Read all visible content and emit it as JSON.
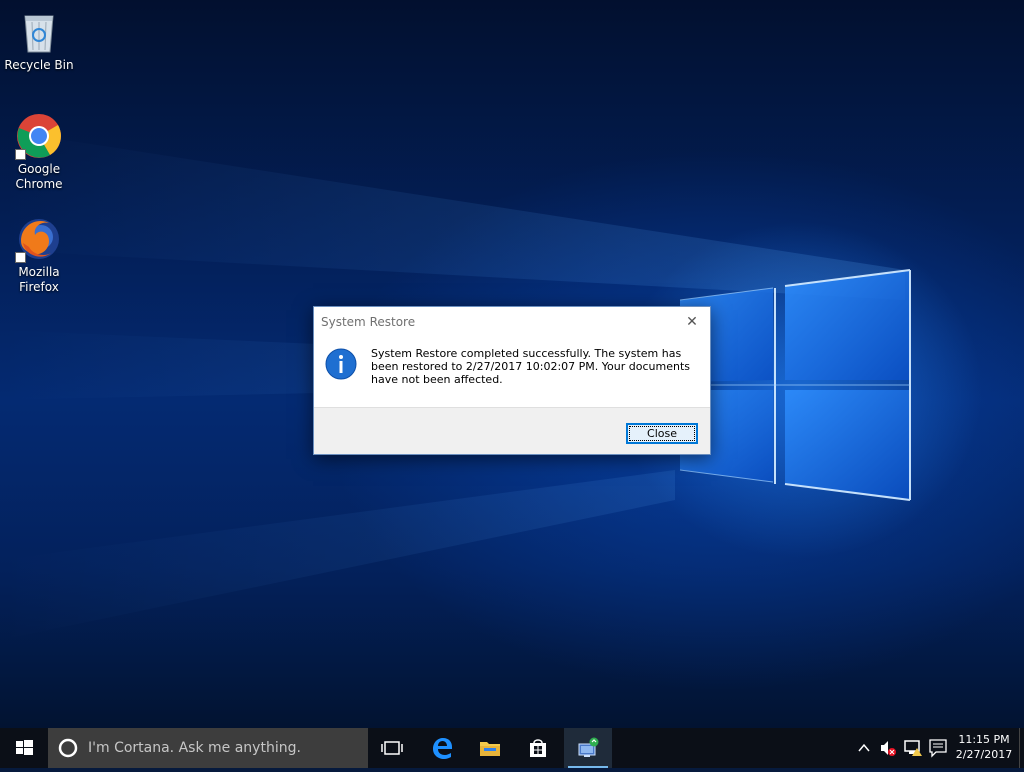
{
  "desktop": {
    "icons": [
      {
        "label": "Recycle Bin"
      },
      {
        "label": "Google Chrome"
      },
      {
        "label": "Mozilla Firefox"
      }
    ]
  },
  "dialog": {
    "title": "System Restore",
    "close_glyph": "✕",
    "message": "System Restore completed successfully. The system has been restored to 2/27/2017 10:02:07 PM. Your documents have not been affected.",
    "button_label": "Close"
  },
  "taskbar": {
    "search_placeholder": "I'm Cortana. Ask me anything.",
    "pinned": [
      "task-view-icon",
      "edge-icon",
      "file-explorer-icon",
      "store-icon",
      "system-restore-icon"
    ],
    "clock": {
      "time": "11:15 PM",
      "date": "2/27/2017"
    }
  },
  "colors": {
    "accent": "#0078d7",
    "taskbar": "#0b0f17",
    "search_box": "#3d3d3d"
  }
}
